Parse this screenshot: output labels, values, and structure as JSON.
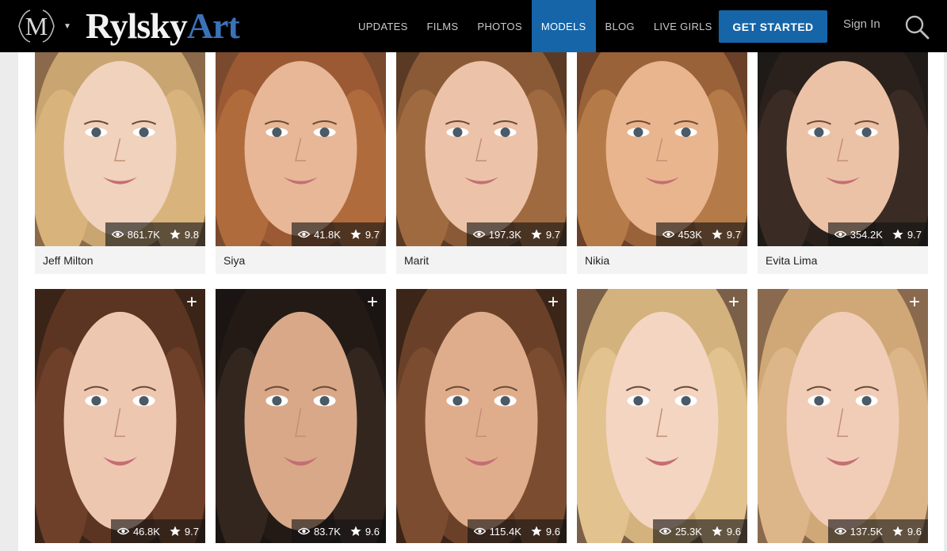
{
  "header": {
    "brand_part1": "Rylsky",
    "brand_part2": "Art",
    "site_logo_letter": "M",
    "nav": [
      {
        "label": "UPDATES",
        "active": false
      },
      {
        "label": "FILMS",
        "active": false
      },
      {
        "label": "PHOTOS",
        "active": false
      },
      {
        "label": "MODELS",
        "active": true
      },
      {
        "label": "BLOG",
        "active": false
      },
      {
        "label": "LIVE GIRLS",
        "active": false,
        "dropdown": true
      }
    ],
    "cta_label": "GET STARTED",
    "signin_label": "Sign In",
    "icons": {
      "site_switcher": "caret-down-icon",
      "search": "search-icon",
      "views": "eye-icon",
      "rating": "star-icon",
      "add": "plus-icon"
    }
  },
  "colors": {
    "topbar": "#000000",
    "accent": "#1565a8",
    "page_bg": "#ececec"
  },
  "models_row1": [
    {
      "name": "Jeff Milton",
      "views": "861.7K",
      "rating": "9.8"
    },
    {
      "name": "Siya",
      "views": "41.8K",
      "rating": "9.7"
    },
    {
      "name": "Marit",
      "views": "197.3K",
      "rating": "9.7"
    },
    {
      "name": "Nikia",
      "views": "453K",
      "rating": "9.7"
    },
    {
      "name": "Evita Lima",
      "views": "354.2K",
      "rating": "9.7"
    }
  ],
  "models_row2": [
    {
      "views": "46.8K",
      "rating": "9.7",
      "add_label": "+"
    },
    {
      "views": "83.7K",
      "rating": "9.6",
      "add_label": "+"
    },
    {
      "views": "115.4K",
      "rating": "9.6",
      "add_label": "+"
    },
    {
      "views": "25.3K",
      "rating": "9.6",
      "add_label": "+"
    },
    {
      "views": "137.5K",
      "rating": "9.6",
      "add_label": "+"
    }
  ]
}
